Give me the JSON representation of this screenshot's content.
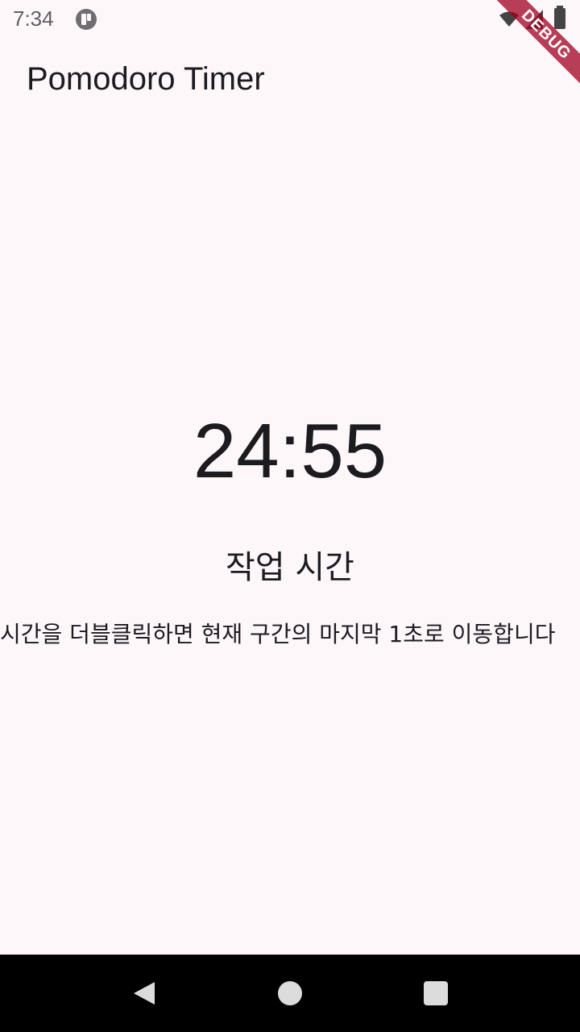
{
  "status_bar": {
    "time": "7:34",
    "icons": [
      "app-notification-icon",
      "wifi-icon",
      "signal-icon",
      "battery-icon"
    ]
  },
  "debug_banner": "DEBUG",
  "app_bar": {
    "title": "Pomodoro Timer"
  },
  "timer": {
    "display": "24:55",
    "phase": "작업 시간",
    "hint": "시간을 더블클릭하면 현재 구간의 마지막 1초로 이동합니다"
  },
  "nav_bar": {
    "icons": [
      "back-icon",
      "home-icon",
      "recents-icon"
    ]
  },
  "colors": {
    "background": "#fdf7fa",
    "text": "#1c1b1f",
    "debug_ribbon": "#a00020",
    "nav_bar": "#000000"
  }
}
